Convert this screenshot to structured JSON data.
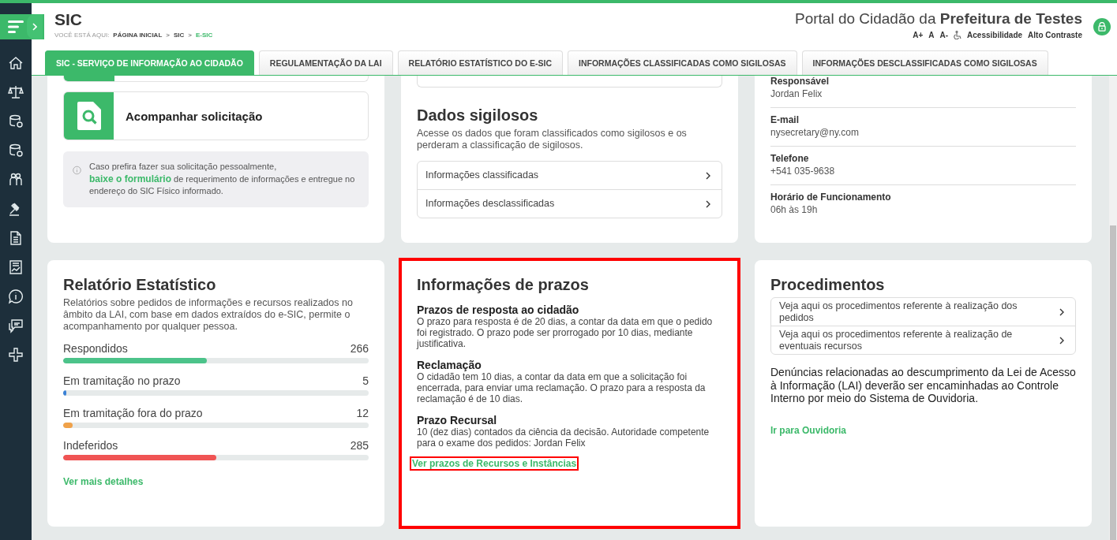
{
  "header": {
    "title": "SIC",
    "breadcrumb_label": "VOCÊ ESTÁ AQUI:",
    "breadcrumb": [
      {
        "label": "PÁGINA INICIAL",
        "selected": false
      },
      {
        "label": "SIC",
        "selected": false
      },
      {
        "label": "E-SIC",
        "selected": true
      }
    ],
    "breadcrumb_separator": ">",
    "portal_title": "Portal do Cidadão da **Prefeitura de Testes**",
    "font_controls": [
      "A+",
      "A",
      "A-"
    ],
    "accessibility": "Acessibilidade",
    "contrast": "Alto Contraste"
  },
  "sidebar": {
    "items": [
      {
        "kind": "home"
      },
      {
        "kind": "scales"
      },
      {
        "kind": "coins"
      },
      {
        "kind": "coins"
      },
      {
        "kind": "people"
      },
      {
        "kind": "gavel"
      },
      {
        "kind": "document"
      },
      {
        "kind": "chart"
      },
      {
        "kind": "info"
      },
      {
        "kind": "chat"
      },
      {
        "kind": "plus"
      }
    ]
  },
  "tabs": [
    {
      "label": "SIC - SERVIÇO DE INFORMAÇÃO AO CIDADÃO",
      "selected": true
    },
    {
      "label": "REGULAMENTAÇÃO DA LAI",
      "selected": false
    },
    {
      "label": "RELATÓRIO ESTATÍSTICO DO E-SIC",
      "selected": false
    },
    {
      "label": "INFORMAÇÕES CLASSIFICADAS COMO SIGILOSAS",
      "selected": false
    },
    {
      "label": "INFORMAÇÕES DESCLASSIFICADAS COMO SIGILOSAS",
      "selected": false
    }
  ],
  "request_card": {
    "button": "Acompanhar solicitação",
    "note_before": "Caso prefira fazer sua solicitação pessoalmente,",
    "note_link": "baixe o formulário",
    "note_after": "de requerimento de informações e entregue no endereço do SIC Físico informado."
  },
  "secret_card": {
    "title": "Dados sigilosos",
    "description": "Acesse os dados que foram classificados como sigilosos e os perderam a classificação de sigilosos.",
    "links": [
      "Informações classificadas",
      "Informações desclassificadas"
    ]
  },
  "contact_card": {
    "fields": [
      {
        "label": "Responsável",
        "value": "Jordan Felix"
      },
      {
        "label": "E-mail",
        "value": "nysecretary@ny.com"
      },
      {
        "label": "Telefone",
        "value": "+541 035-9638"
      },
      {
        "label": "Horário de Funcionamento",
        "value": "06h às 19h"
      }
    ]
  },
  "stats_card": {
    "title": "Relatório Estatístico",
    "description": "Relatórios sobre pedidos de informações e recursos realizados no âmbito da LAI, com base em dados extraídos do e-SIC, permite o acompanhamento por qualquer pessoa.",
    "stats": [
      {
        "label": "Respondidos",
        "count": "266",
        "level": 0.47,
        "color": "#4cc38a"
      },
      {
        "label": "Em tramitação no prazo",
        "count": "5",
        "level": 0.01,
        "color": "#3b82d6"
      },
      {
        "label": "Em tramitação fora do prazo",
        "count": "12",
        "level": 0.03,
        "color": "#f0a24a"
      },
      {
        "label": "Indeferidos",
        "count": "285",
        "level": 0.5,
        "color": "#f05454"
      }
    ],
    "link": "Ver mais detalhes"
  },
  "deadlines_card": {
    "title": "Informações de prazos",
    "highlighted": true,
    "sections": [
      {
        "heading": "Prazos de resposta ao cidadão",
        "text": "O prazo para resposta é de 20 dias, a contar da data em que o pedido foi registrado. O prazo pode ser prorrogado por 10 dias, mediante justificativa."
      },
      {
        "heading": "Reclamação",
        "text": "O cidadão tem 10 dias, a contar da data em que a solicitação foi encerrada, para enviar uma reclamação. O prazo para a resposta da reclamação é de 10 dias."
      },
      {
        "heading": "Prazo Recursal",
        "text": "10 (dez dias) contados da ciência da decisão. Autoridade competente para o exame dos pedidos: Jordan Felix"
      }
    ],
    "link": "Ver prazos de Recursos e Instâncias",
    "link_highlighted": true
  },
  "procedures_card": {
    "title": "Procedimentos",
    "links": [
      "Veja aqui os procedimentos referente à realização dos pedidos",
      "Veja aqui os procedimentos referente à realização de eventuais recursos"
    ],
    "text": "Denúncias relacionadas ao descumprimento da Lei de Acesso à Informação (LAI) deverão ser encaminhadas ao Controle Interno por meio do Sistema de Ouvidoria.",
    "link": "Ir para Ouvidoria"
  }
}
